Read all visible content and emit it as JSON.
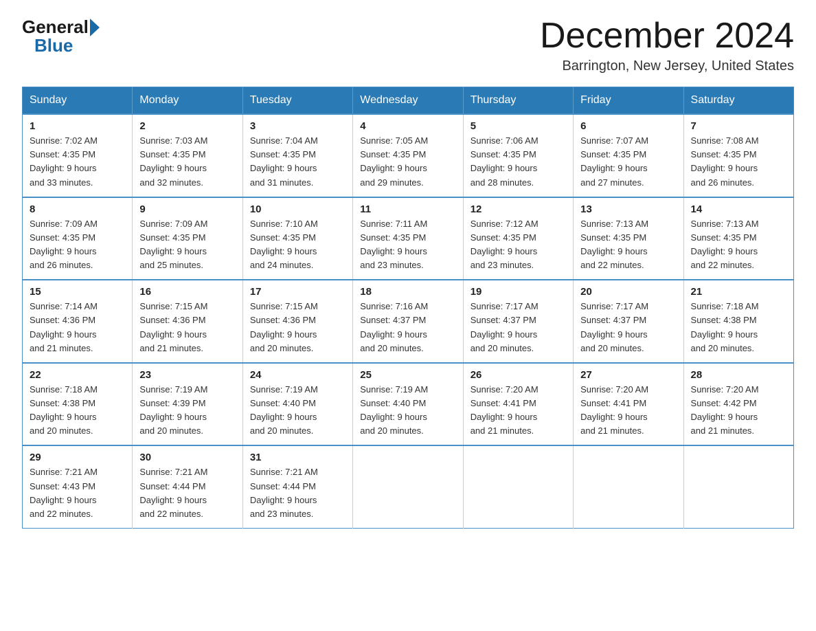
{
  "logo": {
    "general": "General",
    "blue": "Blue"
  },
  "title": "December 2024",
  "subtitle": "Barrington, New Jersey, United States",
  "days_of_week": [
    "Sunday",
    "Monday",
    "Tuesday",
    "Wednesday",
    "Thursday",
    "Friday",
    "Saturday"
  ],
  "weeks": [
    [
      {
        "day": "1",
        "sunrise": "7:02 AM",
        "sunset": "4:35 PM",
        "daylight": "9 hours and 33 minutes."
      },
      {
        "day": "2",
        "sunrise": "7:03 AM",
        "sunset": "4:35 PM",
        "daylight": "9 hours and 32 minutes."
      },
      {
        "day": "3",
        "sunrise": "7:04 AM",
        "sunset": "4:35 PM",
        "daylight": "9 hours and 31 minutes."
      },
      {
        "day": "4",
        "sunrise": "7:05 AM",
        "sunset": "4:35 PM",
        "daylight": "9 hours and 29 minutes."
      },
      {
        "day": "5",
        "sunrise": "7:06 AM",
        "sunset": "4:35 PM",
        "daylight": "9 hours and 28 minutes."
      },
      {
        "day": "6",
        "sunrise": "7:07 AM",
        "sunset": "4:35 PM",
        "daylight": "9 hours and 27 minutes."
      },
      {
        "day": "7",
        "sunrise": "7:08 AM",
        "sunset": "4:35 PM",
        "daylight": "9 hours and 26 minutes."
      }
    ],
    [
      {
        "day": "8",
        "sunrise": "7:09 AM",
        "sunset": "4:35 PM",
        "daylight": "9 hours and 26 minutes."
      },
      {
        "day": "9",
        "sunrise": "7:09 AM",
        "sunset": "4:35 PM",
        "daylight": "9 hours and 25 minutes."
      },
      {
        "day": "10",
        "sunrise": "7:10 AM",
        "sunset": "4:35 PM",
        "daylight": "9 hours and 24 minutes."
      },
      {
        "day": "11",
        "sunrise": "7:11 AM",
        "sunset": "4:35 PM",
        "daylight": "9 hours and 23 minutes."
      },
      {
        "day": "12",
        "sunrise": "7:12 AM",
        "sunset": "4:35 PM",
        "daylight": "9 hours and 23 minutes."
      },
      {
        "day": "13",
        "sunrise": "7:13 AM",
        "sunset": "4:35 PM",
        "daylight": "9 hours and 22 minutes."
      },
      {
        "day": "14",
        "sunrise": "7:13 AM",
        "sunset": "4:35 PM",
        "daylight": "9 hours and 22 minutes."
      }
    ],
    [
      {
        "day": "15",
        "sunrise": "7:14 AM",
        "sunset": "4:36 PM",
        "daylight": "9 hours and 21 minutes."
      },
      {
        "day": "16",
        "sunrise": "7:15 AM",
        "sunset": "4:36 PM",
        "daylight": "9 hours and 21 minutes."
      },
      {
        "day": "17",
        "sunrise": "7:15 AM",
        "sunset": "4:36 PM",
        "daylight": "9 hours and 20 minutes."
      },
      {
        "day": "18",
        "sunrise": "7:16 AM",
        "sunset": "4:37 PM",
        "daylight": "9 hours and 20 minutes."
      },
      {
        "day": "19",
        "sunrise": "7:17 AM",
        "sunset": "4:37 PM",
        "daylight": "9 hours and 20 minutes."
      },
      {
        "day": "20",
        "sunrise": "7:17 AM",
        "sunset": "4:37 PM",
        "daylight": "9 hours and 20 minutes."
      },
      {
        "day": "21",
        "sunrise": "7:18 AM",
        "sunset": "4:38 PM",
        "daylight": "9 hours and 20 minutes."
      }
    ],
    [
      {
        "day": "22",
        "sunrise": "7:18 AM",
        "sunset": "4:38 PM",
        "daylight": "9 hours and 20 minutes."
      },
      {
        "day": "23",
        "sunrise": "7:19 AM",
        "sunset": "4:39 PM",
        "daylight": "9 hours and 20 minutes."
      },
      {
        "day": "24",
        "sunrise": "7:19 AM",
        "sunset": "4:40 PM",
        "daylight": "9 hours and 20 minutes."
      },
      {
        "day": "25",
        "sunrise": "7:19 AM",
        "sunset": "4:40 PM",
        "daylight": "9 hours and 20 minutes."
      },
      {
        "day": "26",
        "sunrise": "7:20 AM",
        "sunset": "4:41 PM",
        "daylight": "9 hours and 21 minutes."
      },
      {
        "day": "27",
        "sunrise": "7:20 AM",
        "sunset": "4:41 PM",
        "daylight": "9 hours and 21 minutes."
      },
      {
        "day": "28",
        "sunrise": "7:20 AM",
        "sunset": "4:42 PM",
        "daylight": "9 hours and 21 minutes."
      }
    ],
    [
      {
        "day": "29",
        "sunrise": "7:21 AM",
        "sunset": "4:43 PM",
        "daylight": "9 hours and 22 minutes."
      },
      {
        "day": "30",
        "sunrise": "7:21 AM",
        "sunset": "4:44 PM",
        "daylight": "9 hours and 22 minutes."
      },
      {
        "day": "31",
        "sunrise": "7:21 AM",
        "sunset": "4:44 PM",
        "daylight": "9 hours and 23 minutes."
      },
      null,
      null,
      null,
      null
    ]
  ],
  "labels": {
    "sunrise": "Sunrise:",
    "sunset": "Sunset:",
    "daylight": "Daylight:"
  }
}
